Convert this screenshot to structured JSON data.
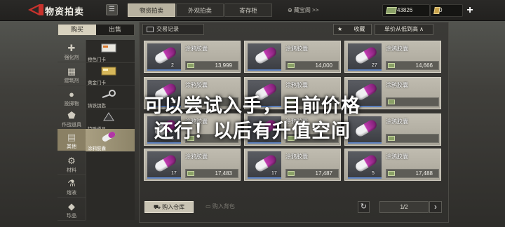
{
  "header": {
    "title": "物资拍卖",
    "tabs": [
      {
        "label": "物资拍卖",
        "active": true
      },
      {
        "label": "外观拍卖",
        "active": false
      },
      {
        "label": "寄存柜",
        "active": false
      }
    ],
    "fav_link": "藏宝阁 >>",
    "currency1": "43826",
    "currency2": "0",
    "currency_color": "#8aa067"
  },
  "side_tabs": {
    "buy": "购买",
    "sell": "出售"
  },
  "categories": [
    {
      "label": "强化剂",
      "icon": "syringe-icon"
    },
    {
      "label": "建筑剂",
      "icon": "build-icon"
    },
    {
      "label": "投掷物",
      "icon": "grenade-icon"
    },
    {
      "label": "作战道具",
      "icon": "shield-icon"
    },
    {
      "label": "其他",
      "icon": "box-icon",
      "selected": true
    },
    {
      "label": "材料",
      "icon": "gear-icon"
    },
    {
      "label": "熔液",
      "icon": "flask-icon"
    },
    {
      "label": "珍品",
      "icon": "gem-icon"
    }
  ],
  "subcategories": [
    {
      "label": "橙色门卡"
    },
    {
      "label": "黄金门卡"
    },
    {
      "label": "铸铁钥匙"
    },
    {
      "label": "特殊道具"
    },
    {
      "label": "涂鸦胶囊",
      "selected": true
    }
  ],
  "toolbar": {
    "trade_record": "交易记录",
    "favorite": "收藏",
    "sort": "单价从低到高 ∧"
  },
  "listings": [
    {
      "name": "涂鸦胶囊",
      "qty": "2",
      "price": "13,999"
    },
    {
      "name": "涂鸦胶囊",
      "qty": "",
      "price": "14,000"
    },
    {
      "name": "涂鸦胶囊",
      "qty": "27",
      "price": "14,666"
    },
    {
      "name": "涂鸦胶囊",
      "qty": "17",
      "price": ""
    },
    {
      "name": "涂鸦胶囊",
      "qty": "",
      "price": ""
    },
    {
      "name": "涂鸦胶囊",
      "qty": "",
      "price": ""
    },
    {
      "name": "涂鸦胶囊",
      "qty": "3",
      "price": ""
    },
    {
      "name": "涂鸦胶囊",
      "qty": "",
      "price": ""
    },
    {
      "name": "涂鸦胶囊",
      "qty": "",
      "price": ""
    },
    {
      "name": "涂鸦胶囊",
      "qty": "17",
      "price": "17,483"
    },
    {
      "name": "涂鸦胶囊",
      "qty": "17",
      "price": "17,487"
    },
    {
      "name": "涂鸦胶囊",
      "qty": "5",
      "price": "17,488"
    }
  ],
  "footer": {
    "buy_warehouse": "购入仓库",
    "buy_bag": "购入背包",
    "page": "1/2"
  },
  "overlay_text": [
    "可以尝试入手，目前价格",
    "还行！以后有升值空间"
  ]
}
